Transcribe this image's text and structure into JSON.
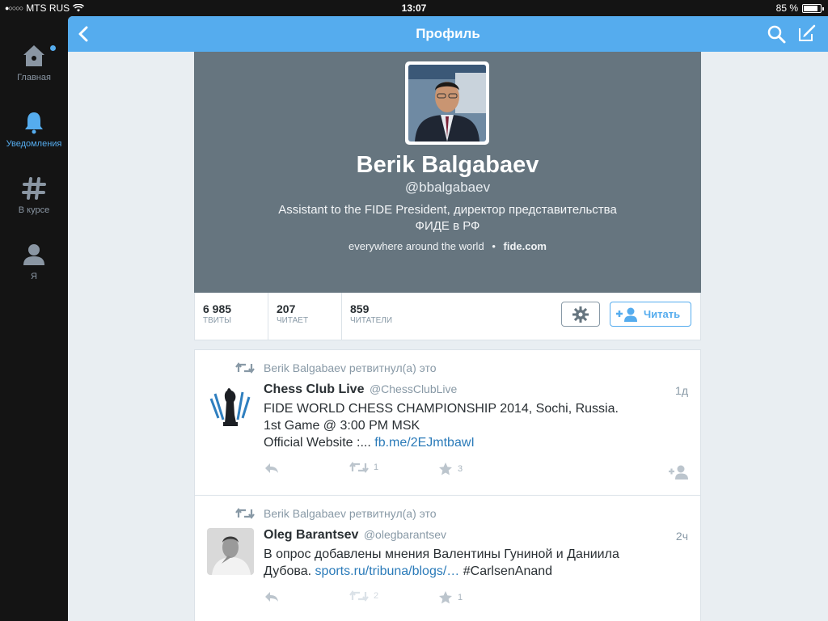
{
  "status_bar": {
    "carrier": "MTS RUS",
    "time": "13:07",
    "battery": "85 %",
    "battery_level": 0.85
  },
  "sidebar": {
    "items": [
      {
        "label": "Главная",
        "icon": "home-icon"
      },
      {
        "label": "Уведомления",
        "icon": "bell-icon"
      },
      {
        "label": "В курсе",
        "icon": "hashtag-icon"
      },
      {
        "label": "Я",
        "icon": "user-icon"
      }
    ]
  },
  "topbar": {
    "title": "Профиль"
  },
  "profile": {
    "name": "Berik Balgabaev",
    "handle": "@bbalgabaev",
    "bio_line1": "Assistant to the FIDE President, директор представительства",
    "bio_line2": "ФИДЕ в РФ",
    "location": "everywhere around the world",
    "separator": "•",
    "url": "fide.com"
  },
  "stats": [
    {
      "value": "6 985",
      "label": "ТВИТЫ"
    },
    {
      "value": "207",
      "label": "ЧИТАЕТ"
    },
    {
      "value": "859",
      "label": "ЧИТАТЕЛИ"
    }
  ],
  "follow_label": "Читать",
  "tweets": [
    {
      "retweeted_by": "Berik Balgabaev ретвитнул(а) это",
      "name": "Chess Club Live",
      "handle": "@ChessClubLive",
      "time": "1д",
      "line1": "FIDE WORLD CHESS CHAMPIONSHIP 2014, Sochi, Russia.",
      "line2": "1st Game @ 3:00 PM MSK",
      "line3_prefix": "Official Website :...",
      "line3_link": "fb.me/2EJmtbawI",
      "retweets": "1",
      "favorites": "3"
    },
    {
      "retweeted_by": "Berik Balgabaev ретвитнул(а) это",
      "name": "Oleg Barantsev",
      "handle": "@olegbarantsev",
      "time": "2ч",
      "line1": "В опрос добавлены мнения Валентины Гуниной и Даниила",
      "line2_prefix": "Дубова.",
      "line2_link": "sports.ru/tribuna/blogs/…",
      "line2_suffix": "#CarlsenAnand",
      "retweets": "2",
      "favorites": "1"
    }
  ],
  "colors": {
    "accent": "#55acee",
    "header_bg": "#66757f",
    "link": "#2b7bb9"
  }
}
